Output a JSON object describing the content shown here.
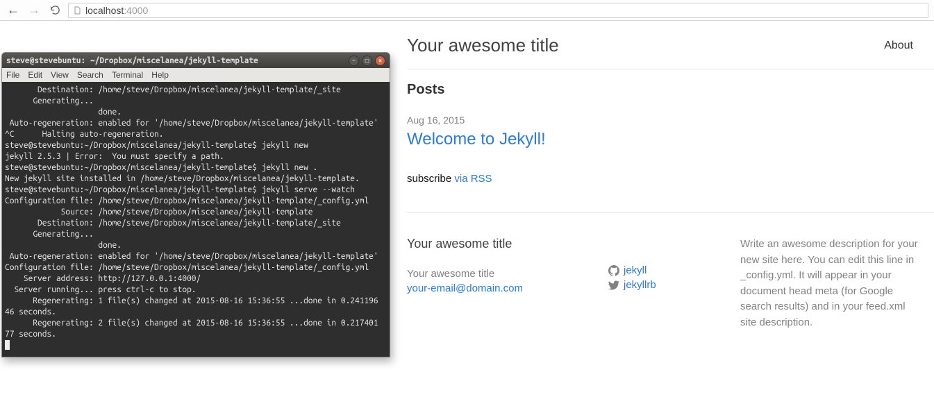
{
  "browser": {
    "url_host": "localhost",
    "url_port": ":4000"
  },
  "terminal": {
    "title": "steve@stevebuntu: ~/Dropbox/miscelanea/jekyll-template",
    "menu": [
      "File",
      "Edit",
      "View",
      "Search",
      "Terminal",
      "Help"
    ],
    "lines": [
      "       Destination: /home/steve/Dropbox/miscelanea/jekyll-template/_site",
      "      Generating...",
      "                    done.",
      " Auto-regeneration: enabled for '/home/steve/Dropbox/miscelanea/jekyll-template'",
      "^C      Halting auto-regeneration.",
      "steve@stevebuntu:~/Dropbox/miscelanea/jekyll-template$ jekyll new",
      "jekyll 2.5.3 | Error:  You must specify a path.",
      "steve@stevebuntu:~/Dropbox/miscelanea/jekyll-template$ jekyll new .",
      "New jekyll site installed in /home/steve/Dropbox/miscelanea/jekyll-template.",
      "steve@stevebuntu:~/Dropbox/miscelanea/jekyll-template$ jekyll serve --watch",
      "Configuration file: /home/steve/Dropbox/miscelanea/jekyll-template/_config.yml",
      "            Source: /home/steve/Dropbox/miscelanea/jekyll-template",
      "       Destination: /home/steve/Dropbox/miscelanea/jekyll-template/_site",
      "      Generating...",
      "                    done.",
      " Auto-regeneration: enabled for '/home/steve/Dropbox/miscelanea/jekyll-template'",
      "Configuration file: /home/steve/Dropbox/miscelanea/jekyll-template/_config.yml",
      "    Server address: http://127.0.0.1:4000/",
      "  Server running... press ctrl-c to stop.",
      "      Regenerating: 1 file(s) changed at 2015-08-16 15:36:55 ...done in 0.241196",
      "46 seconds.",
      "      Regenerating: 2 file(s) changed at 2015-08-16 15:36:55 ...done in 0.217401",
      "77 seconds."
    ]
  },
  "site": {
    "title": "Your awesome title",
    "nav_about": "About",
    "posts_heading": "Posts",
    "post_date": "Aug 16, 2015",
    "post_title": "Welcome to Jekyll!",
    "subscribe_prefix": "subscribe ",
    "subscribe_link": "via RSS",
    "footer_title": "Your awesome title",
    "contact_name": "Your awesome title",
    "contact_email": "your-email@domain.com",
    "github_user": "jekyll",
    "twitter_user": "jekyllrb",
    "description": "Write an awesome description for your new site here. You can edit this line in _config.yml. It will appear in your document head meta (for Google search results) and in your feed.xml site description."
  }
}
